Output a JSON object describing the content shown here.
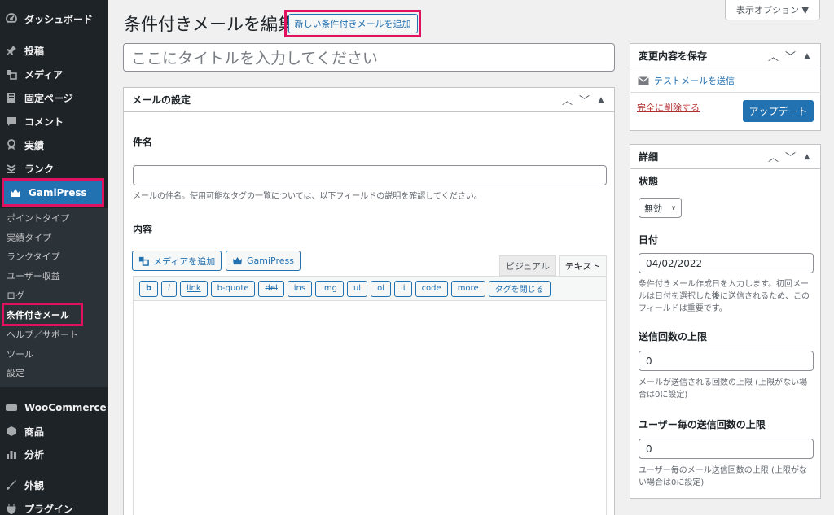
{
  "sidebar": {
    "menu": [
      {
        "label": "ダッシュボード",
        "icon": "dashboard-icon"
      },
      {
        "label": "投稿",
        "icon": "pin-icon"
      },
      {
        "label": "メディア",
        "icon": "media-icon"
      },
      {
        "label": "固定ページ",
        "icon": "page-icon"
      },
      {
        "label": "コメント",
        "icon": "comment-icon"
      },
      {
        "label": "実績",
        "icon": "award-icon"
      },
      {
        "label": "ランク",
        "icon": "rank-icon"
      },
      {
        "label": "GamiPress",
        "icon": "crown-icon"
      }
    ],
    "submenu": [
      "ポイントタイプ",
      "実績タイプ",
      "ランクタイプ",
      "ユーザー収益",
      "ログ",
      "条件付きメール",
      "ヘルプ／サポート",
      "ツール",
      "設定"
    ],
    "menu_bottom": [
      {
        "label": "WooCommerce",
        "icon": "woocommerce-icon"
      },
      {
        "label": "商品",
        "icon": "product-icon"
      },
      {
        "label": "分析",
        "icon": "analytics-icon"
      },
      {
        "label": "外観",
        "icon": "appearance-icon"
      },
      {
        "label": "プラグイン",
        "icon": "plugin-icon"
      }
    ]
  },
  "screen_options": {
    "label": "表示オプション ▼"
  },
  "header": {
    "title": "条件付きメールを編集",
    "add_new": "新しい条件付きメールを追加"
  },
  "title_field": {
    "placeholder": "ここにタイトルを入力してください"
  },
  "mail_settings": {
    "title": "メールの設定",
    "subject_label": "件名",
    "subject_value": "",
    "subject_desc": "メールの件名。使用可能なタグの一覧については、以下フィールドの説明を確認してください。",
    "content_label": "内容",
    "add_media": "メディアを追加",
    "gamipress_btn": "GamiPress",
    "tab_visual": "ビジュアル",
    "tab_text": "テキスト",
    "quicktags": [
      "b",
      "i",
      "link",
      "b-quote",
      "del",
      "ins",
      "img",
      "ul",
      "ol",
      "li",
      "code",
      "more",
      "タグを閉じる"
    ]
  },
  "save_box": {
    "title": "変更内容を保存",
    "test_mail": "テストメールを送信",
    "delete": "完全に削除する",
    "update": "アップデート"
  },
  "details_box": {
    "title": "詳細",
    "status_label": "状態",
    "status_value": "無効",
    "date_label": "日付",
    "date_value": "04/02/2022",
    "date_desc_pre": "条件付きメール作成日を入力します。初回メールは日付を選択した",
    "date_desc_bold": "後",
    "date_desc_post": "に送信されるため、このフィールドは重要です。",
    "send_limit_label": "送信回数の上限",
    "send_limit_value": "0",
    "send_limit_desc": "メールが送信される回数の上限 (上限がない場合は0に設定)",
    "user_limit_label": "ユーザー毎の送信回数の上限",
    "user_limit_value": "0",
    "user_limit_desc": "ユーザー毎のメール送信回数の上限 (上限がない場合は0に設定)"
  },
  "colors": {
    "accent": "#2271b1",
    "highlight": "#e0115f",
    "sidebar_bg": "#1d2327"
  }
}
